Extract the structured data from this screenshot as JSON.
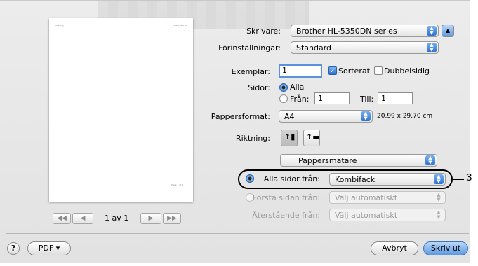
{
  "printer": {
    "label": "Skrivare:",
    "value": "Brother HL-5350DN series"
  },
  "presets": {
    "label": "Förinställningar:",
    "value": "Standard"
  },
  "copies": {
    "label": "Exemplar:",
    "value": "1",
    "collated_label": "Sorterat",
    "collated": true,
    "duplex_label": "Dubbelsidig",
    "duplex": false
  },
  "pages": {
    "label": "Sidor:",
    "all_label": "Alla",
    "from_label": "Från:",
    "from_value": "1",
    "to_label": "Till:",
    "to_value": "1"
  },
  "paper_size": {
    "label": "Pappersformat:",
    "value": "A4",
    "dimensions": "20.99 x 29.70 cm"
  },
  "orientation": {
    "label": "Riktning:"
  },
  "panel": {
    "value": "Pappersmatare"
  },
  "paper_feed": {
    "all_pages_label": "Alla sidor från:",
    "all_pages_value": "Kombifack",
    "first_page_label": "Första sidan från:",
    "first_page_value": "Välj automatiskt",
    "remaining_label": "Återstående från:",
    "remaining_value": "Välj automatiskt"
  },
  "callout": "3",
  "preview": {
    "page_info": "1 av 1",
    "header_left": "Heading",
    "header_right": "Label text 12",
    "footer": "Page 1 of 1"
  },
  "footer": {
    "help": "?",
    "pdf_label": "PDF ▾",
    "cancel_label": "Avbryt",
    "print_label": "Skriv ut"
  },
  "colors": {
    "accent": "#2d72d0",
    "dialog_bg": "#e8e8e8"
  }
}
